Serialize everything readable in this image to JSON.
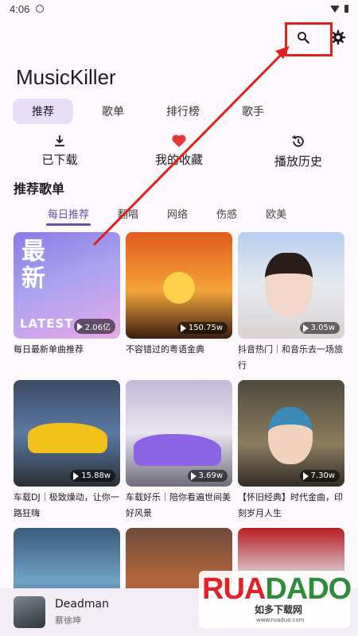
{
  "status_bar": {
    "time": "4:06"
  },
  "app": {
    "title": "MusicKiller"
  },
  "main_tabs": [
    {
      "label": "推荐",
      "active": true
    },
    {
      "label": "歌单",
      "active": false
    },
    {
      "label": "排行榜",
      "active": false
    },
    {
      "label": "歌手",
      "active": false
    }
  ],
  "quick_actions": [
    {
      "label": "已下载",
      "icon": "download-icon"
    },
    {
      "label": "我的收藏",
      "icon": "heart-icon"
    },
    {
      "label": "播放历史",
      "icon": "history-icon"
    }
  ],
  "section": {
    "title": "推荐歌单"
  },
  "category_tabs": [
    {
      "label": "每日推荐",
      "active": true
    },
    {
      "label": "翻唱",
      "active": false
    },
    {
      "label": "网络",
      "active": false
    },
    {
      "label": "伤感",
      "active": false
    },
    {
      "label": "欧美",
      "active": false
    }
  ],
  "playlists": [
    {
      "title": "每日最新单曲推荐",
      "count": "2.06亿",
      "cover_text_1": "最",
      "cover_text_2": "新",
      "cover_text_3": "LATEST"
    },
    {
      "title": "不容错过的粤语金典",
      "count": "150.75w"
    },
    {
      "title": "抖音热门｜和音乐去一场旅行",
      "count": "3.05w"
    },
    {
      "title": "车载DJ｜极致燥动，让你一路狂嗨",
      "count": "15.88w"
    },
    {
      "title": "车载好乐｜陪你看遍世间美好风景",
      "count": "3.69w"
    },
    {
      "title": "【怀旧经典】时代金曲，印刻岁月人生",
      "count": "7.30w"
    },
    {
      "title": "",
      "count": ""
    },
    {
      "title": "",
      "count": ""
    },
    {
      "title": "",
      "count": ""
    }
  ],
  "now_playing": {
    "song": "Deadman",
    "artist": "蔡徐坤"
  },
  "watermark": {
    "brand_ru": "RUA",
    "brand_do": "DADO",
    "cn": "如多下载网",
    "url": "www.ruaduo.com"
  },
  "colors": {
    "accent": "#6750a4",
    "highlight": "#e0201b",
    "background": "#fcf8fc"
  }
}
